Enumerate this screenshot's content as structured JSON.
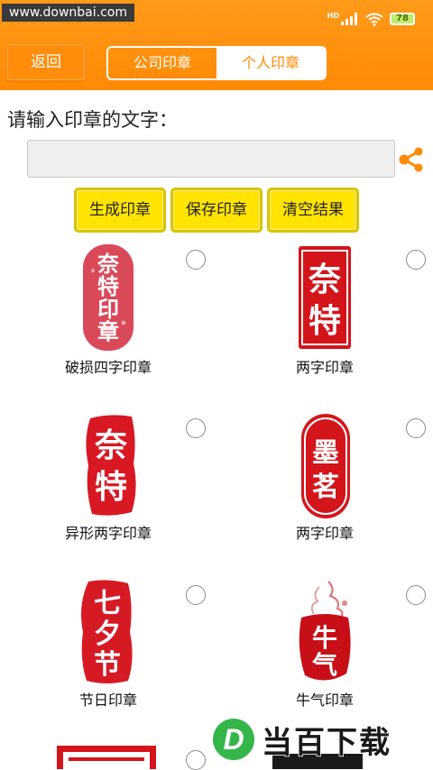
{
  "status_bar": {
    "watermark": "www.downbai.com",
    "network": "HD",
    "battery": "78",
    "icons": [
      "signal-icon",
      "wifi-icon",
      "battery-icon"
    ]
  },
  "header": {
    "back_label": "返回",
    "tabs": [
      {
        "label": "公司印章",
        "selected": false
      },
      {
        "label": "个人印章",
        "selected": true
      }
    ],
    "accent_color": "#ff8a05"
  },
  "form": {
    "prompt": "请输入印章的文字：",
    "input_value": "",
    "input_placeholder": "",
    "share_icon": "share-icon",
    "share_color": "#ff8a05"
  },
  "actions": {
    "generate": "生成印章",
    "save": "保存印章",
    "clear": "清空结果"
  },
  "stamps": [
    {
      "caption": "破损四字印章",
      "chars": [
        "奈",
        "特",
        "印",
        "章"
      ],
      "color": "#d9495a"
    },
    {
      "caption": "两字印章",
      "chars": [
        "奈",
        "特"
      ],
      "color": "#d4141b"
    },
    {
      "caption": "异形两字印章",
      "chars": [
        "奈",
        "特"
      ],
      "color": "#d81822"
    },
    {
      "caption": "两字印章",
      "chars": [
        "墨",
        "茗"
      ],
      "color": "#d4151c"
    },
    {
      "caption": "节日印章",
      "chars": [
        "七",
        "夕",
        "节"
      ],
      "color": "#d61a24"
    },
    {
      "caption": "牛气印章",
      "chars": [
        "牛",
        "气"
      ],
      "color": "#c80f18"
    }
  ],
  "footer": {
    "brand_logo": "D",
    "brand_text": "当百下载",
    "brand_color": "#35b64a"
  }
}
